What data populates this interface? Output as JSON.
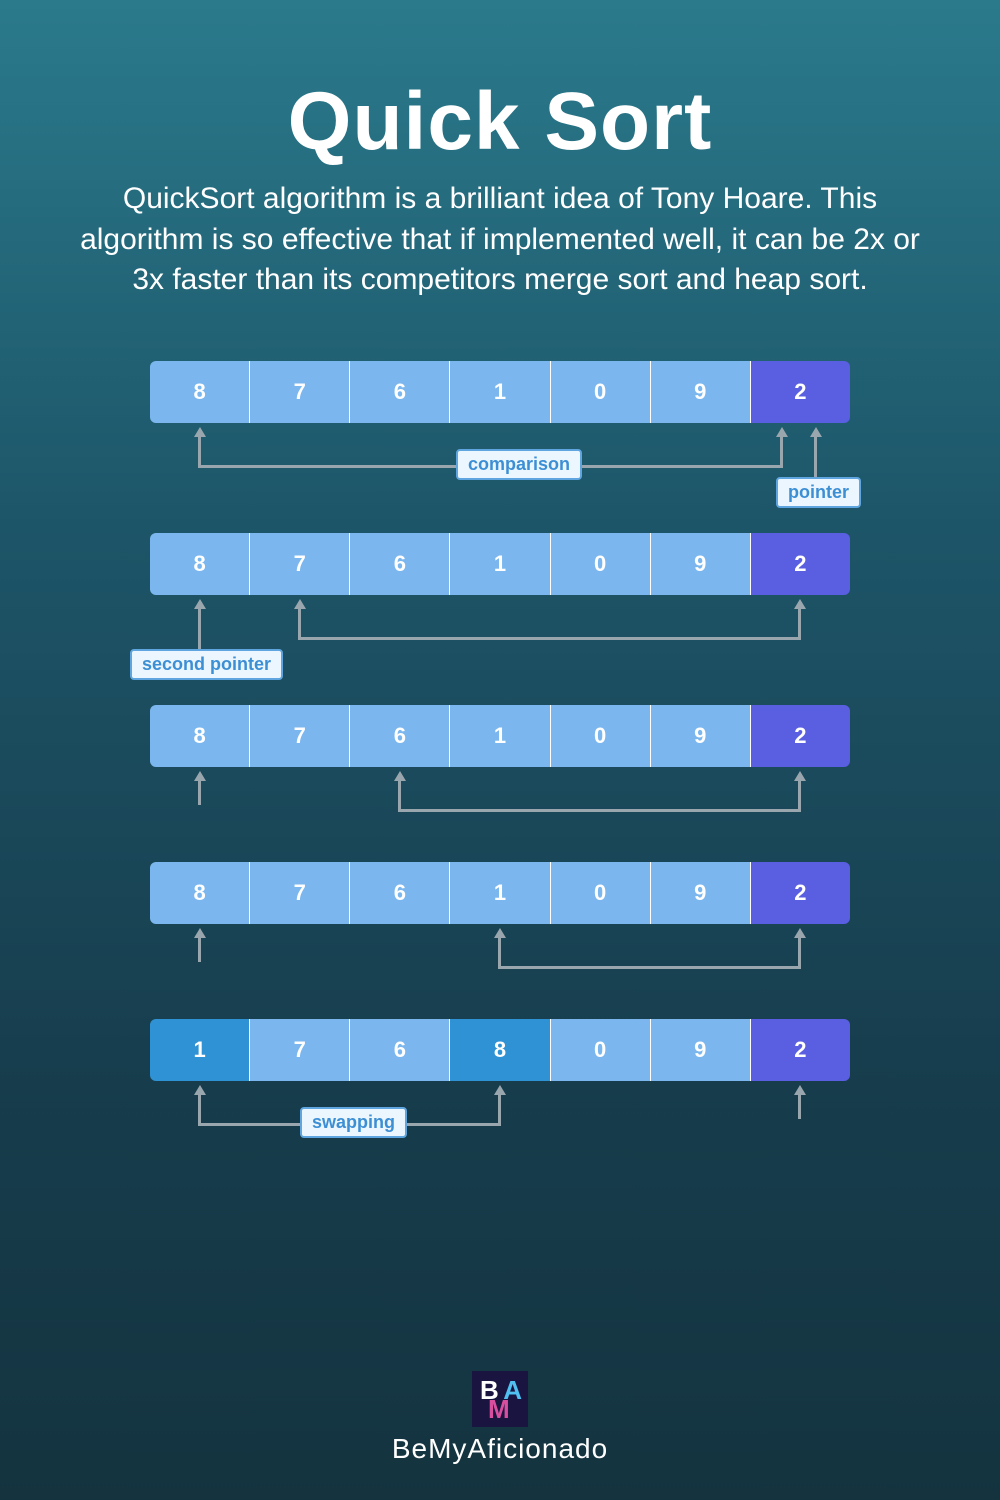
{
  "title": "Quick Sort",
  "description": "QuickSort algorithm is a brilliant idea of Tony Hoare. This algorithm is so effective that if implemented well, it can be 2x or 3x faster than its competitors merge sort and heap sort.",
  "labels": {
    "comparison": "comparison",
    "pointer": "pointer",
    "second_pointer": "second pointer",
    "swapping": "swapping"
  },
  "steps": [
    {
      "values": [
        "8",
        "7",
        "6",
        "1",
        "0",
        "9",
        "2"
      ],
      "styles": [
        "",
        "",
        "",
        "",
        "",
        "",
        "pivot"
      ]
    },
    {
      "values": [
        "8",
        "7",
        "6",
        "1",
        "0",
        "9",
        "2"
      ],
      "styles": [
        "",
        "",
        "",
        "",
        "",
        "",
        "pivot"
      ]
    },
    {
      "values": [
        "8",
        "7",
        "6",
        "1",
        "0",
        "9",
        "2"
      ],
      "styles": [
        "",
        "",
        "",
        "",
        "",
        "",
        "pivot"
      ]
    },
    {
      "values": [
        "8",
        "7",
        "6",
        "1",
        "0",
        "9",
        "2"
      ],
      "styles": [
        "",
        "",
        "",
        "",
        "",
        "",
        "pivot"
      ]
    },
    {
      "values": [
        "1",
        "7",
        "6",
        "8",
        "0",
        "9",
        "2"
      ],
      "styles": [
        "swap",
        "",
        "",
        "swap",
        "",
        "",
        "pivot"
      ]
    }
  ],
  "brand": "BeMyAficionado",
  "logo_letters": {
    "b": "B",
    "a": "A",
    "m": "M"
  },
  "colors": {
    "cell_normal": "#7bb7ee",
    "cell_pivot": "#5a5ee0",
    "cell_swap": "#2f92d4",
    "arrow": "#9aa6ad",
    "label_bg": "#ecf6ff",
    "label_text": "#3d8fd4",
    "label_border": "#5fa5e0"
  }
}
